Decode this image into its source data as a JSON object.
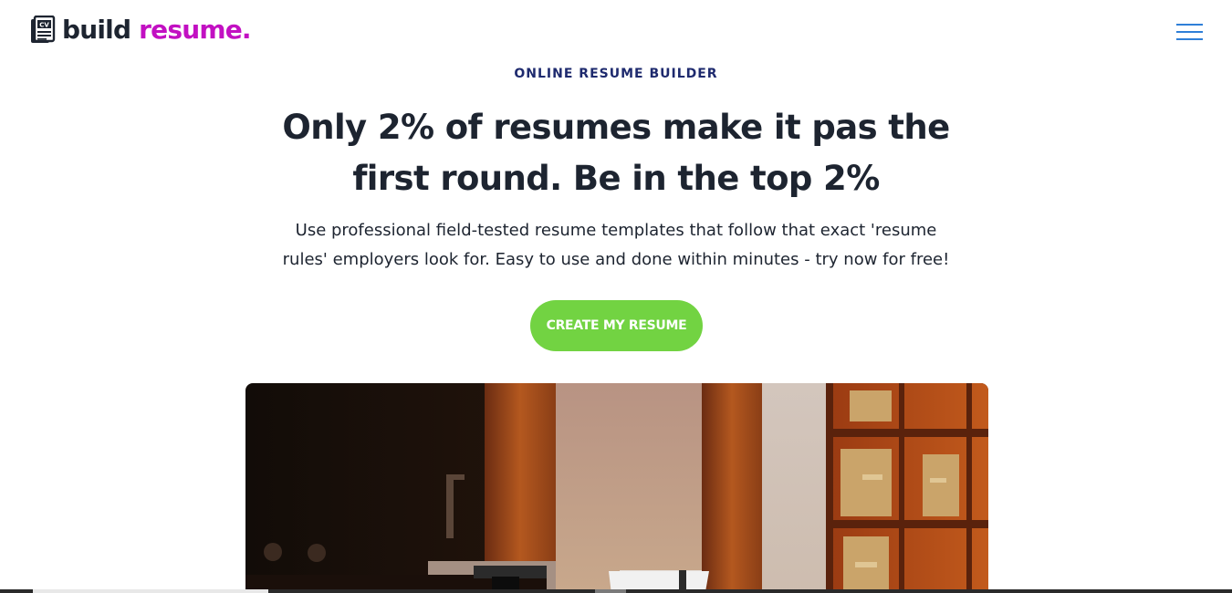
{
  "brand": {
    "word1": "build",
    "word2": "resume.",
    "icon_text": "CV",
    "icon": "cv-document-icon",
    "accent_color": "#c210c2"
  },
  "nav": {
    "menu_icon": "hamburger-menu-icon",
    "menu_color": "#2f7fd8"
  },
  "hero": {
    "eyebrow": "ONLINE RESUME BUILDER",
    "headline_line1": "Only 2% of resumes make it pas the",
    "headline_line2": "first round. Be in the top 2%",
    "subtext_line1": "Use professional field-tested resume templates that follow that exact 'resume",
    "subtext_line2": "rules' employers look for. Easy to use and done within minutes - try now for free!",
    "cta_label": "CREATE MY RESUME",
    "cta_color": "#72d342"
  }
}
